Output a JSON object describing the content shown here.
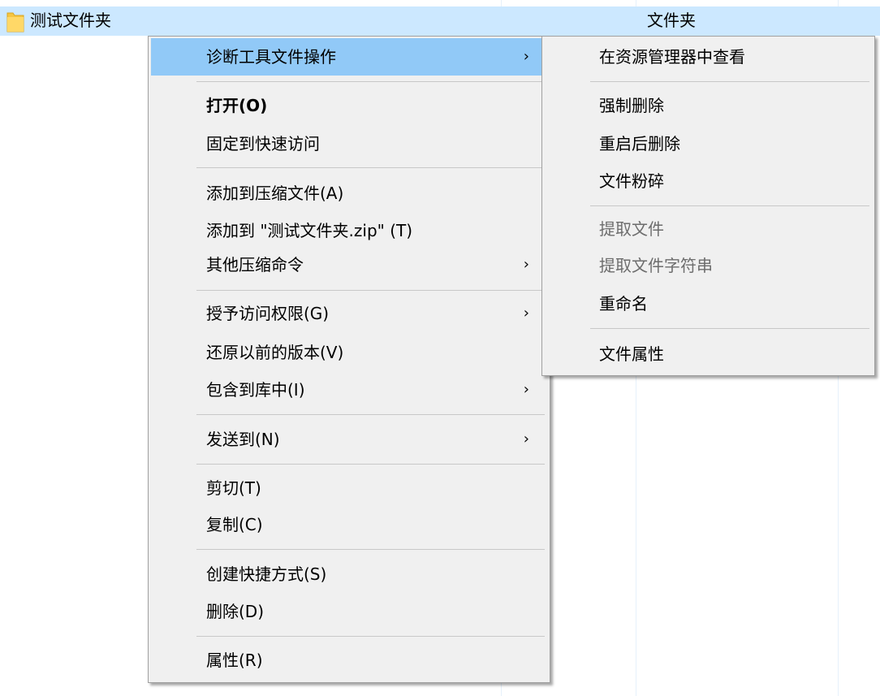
{
  "explorer": {
    "folder_name": "测试文件夹",
    "folder_type": "文件夹"
  },
  "context_menu": {
    "items": [
      {
        "label": "诊断工具文件操作",
        "submenu": true
      },
      {
        "label": "打开(O)"
      },
      {
        "label": "固定到快速访问"
      },
      {
        "label": "添加到压缩文件(A)"
      },
      {
        "label": "添加到 \"测试文件夹.zip\" (T)"
      },
      {
        "label": "其他压缩命令",
        "submenu": true
      },
      {
        "label": "授予访问权限(G)",
        "submenu": true
      },
      {
        "label": "还原以前的版本(V)"
      },
      {
        "label": "包含到库中(I)",
        "submenu": true
      },
      {
        "label": "发送到(N)",
        "submenu": true
      },
      {
        "label": "剪切(T)"
      },
      {
        "label": "复制(C)"
      },
      {
        "label": "创建快捷方式(S)"
      },
      {
        "label": "删除(D)"
      },
      {
        "label": "属性(R)"
      }
    ],
    "arrow": "›"
  },
  "submenu": {
    "items": [
      {
        "label": "在资源管理器中查看"
      },
      {
        "label": "强制删除"
      },
      {
        "label": "重启后删除"
      },
      {
        "label": "文件粉碎"
      },
      {
        "label": "提取文件",
        "enabled": false
      },
      {
        "label": "提取文件字符串",
        "enabled": false
      },
      {
        "label": "重命名"
      },
      {
        "label": "文件属性"
      }
    ]
  },
  "colors": {
    "highlight": "#91c9f7",
    "selected_row": "#cce8ff",
    "menu_bg": "#f0f0f0",
    "disabled_text": "#6d6d6d"
  }
}
